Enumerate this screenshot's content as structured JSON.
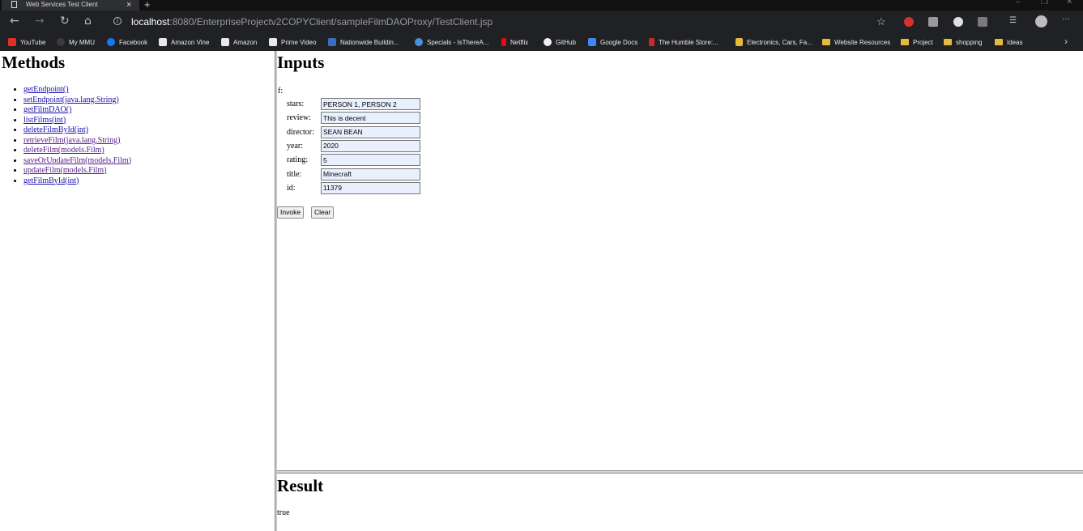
{
  "browser": {
    "tab_title": "Web Services Test Client",
    "tab_close": "×",
    "new_tab": "+",
    "window_controls": [
      "–",
      "❐",
      "✕"
    ],
    "url_host": "localhost",
    "url_rest": ":8080/EnterpriseProjectv2COPYClient/sampleFilmDAOProxy/TestClient.jsp",
    "bookmarks": [
      {
        "label": "YouTube",
        "icon": "youtube-icon",
        "color": "#e52d27"
      },
      {
        "label": "My MMU",
        "icon": "mmu-icon",
        "color": "#3a3a3a"
      },
      {
        "label": "Facebook",
        "icon": "facebook-icon",
        "color": "#1877f2"
      },
      {
        "label": "Amazon Vine",
        "icon": "amazon-icon",
        "color": "#e8e8e8"
      },
      {
        "label": "Amazon",
        "icon": "amazon-icon",
        "color": "#e8e8e8"
      },
      {
        "label": "Prime Video",
        "icon": "amazon-icon",
        "color": "#e8e8e8"
      },
      {
        "label": "Nationwide Buildin...",
        "icon": "nationwide-icon",
        "color": "#3b6ec0"
      },
      {
        "label": "Specials - IsThereA...",
        "icon": "itad-icon",
        "color": "#4a8fe0"
      },
      {
        "label": "Netflix",
        "icon": "netflix-icon",
        "color": "#e50914"
      },
      {
        "label": "GitHub",
        "icon": "github-icon",
        "color": "#f0f0f0"
      },
      {
        "label": "Google Docs",
        "icon": "google-docs-icon",
        "color": "#4285f4"
      },
      {
        "label": "The Humble Store:...",
        "icon": "humble-icon",
        "color": "#cc2929"
      },
      {
        "label": "Electronics, Cars, Fa...",
        "icon": "ebay-icon",
        "color": "#e8b93a"
      },
      {
        "label": "Website Resources",
        "icon": "folder-icon",
        "color": "#e8b93a"
      },
      {
        "label": "Project",
        "icon": "folder-icon",
        "color": "#e8b93a"
      },
      {
        "label": "shopping",
        "icon": "folder-icon",
        "color": "#e8b93a"
      },
      {
        "label": "Ideas",
        "icon": "folder-icon",
        "color": "#e8b93a"
      }
    ],
    "bookmarks_more": "›"
  },
  "methods": {
    "title": "Methods",
    "items": [
      {
        "label": "getEndpoint()"
      },
      {
        "label": "setEndpoint(java.lang.String)"
      },
      {
        "label": "getFilmDAO()"
      },
      {
        "label": "listFilms(int)"
      },
      {
        "label": "deleteFilmById(int)"
      },
      {
        "label": "retrieveFilm(java.lang.String)"
      },
      {
        "label": "deleteFilm(models.Film)"
      },
      {
        "label": "saveOrUpdateFilm(models.Film)"
      },
      {
        "label": "updateFilm(models.Film)"
      },
      {
        "label": "getFilmById(int)"
      }
    ]
  },
  "inputs": {
    "title": "Inputs",
    "param_label": "f:",
    "fields": [
      {
        "label": "stars:",
        "value": "PERSON 1, PERSON 2"
      },
      {
        "label": "review:",
        "value": "This is decent"
      },
      {
        "label": "director:",
        "value": "SEAN BEAN"
      },
      {
        "label": "year:",
        "value": "2020"
      },
      {
        "label": "rating:",
        "value": "5"
      },
      {
        "label": "title:",
        "value": "Minecraft"
      },
      {
        "label": "id:",
        "value": "11379"
      }
    ],
    "invoke_label": "Invoke",
    "clear_label": "Clear"
  },
  "result": {
    "title": "Result",
    "value": "true"
  }
}
